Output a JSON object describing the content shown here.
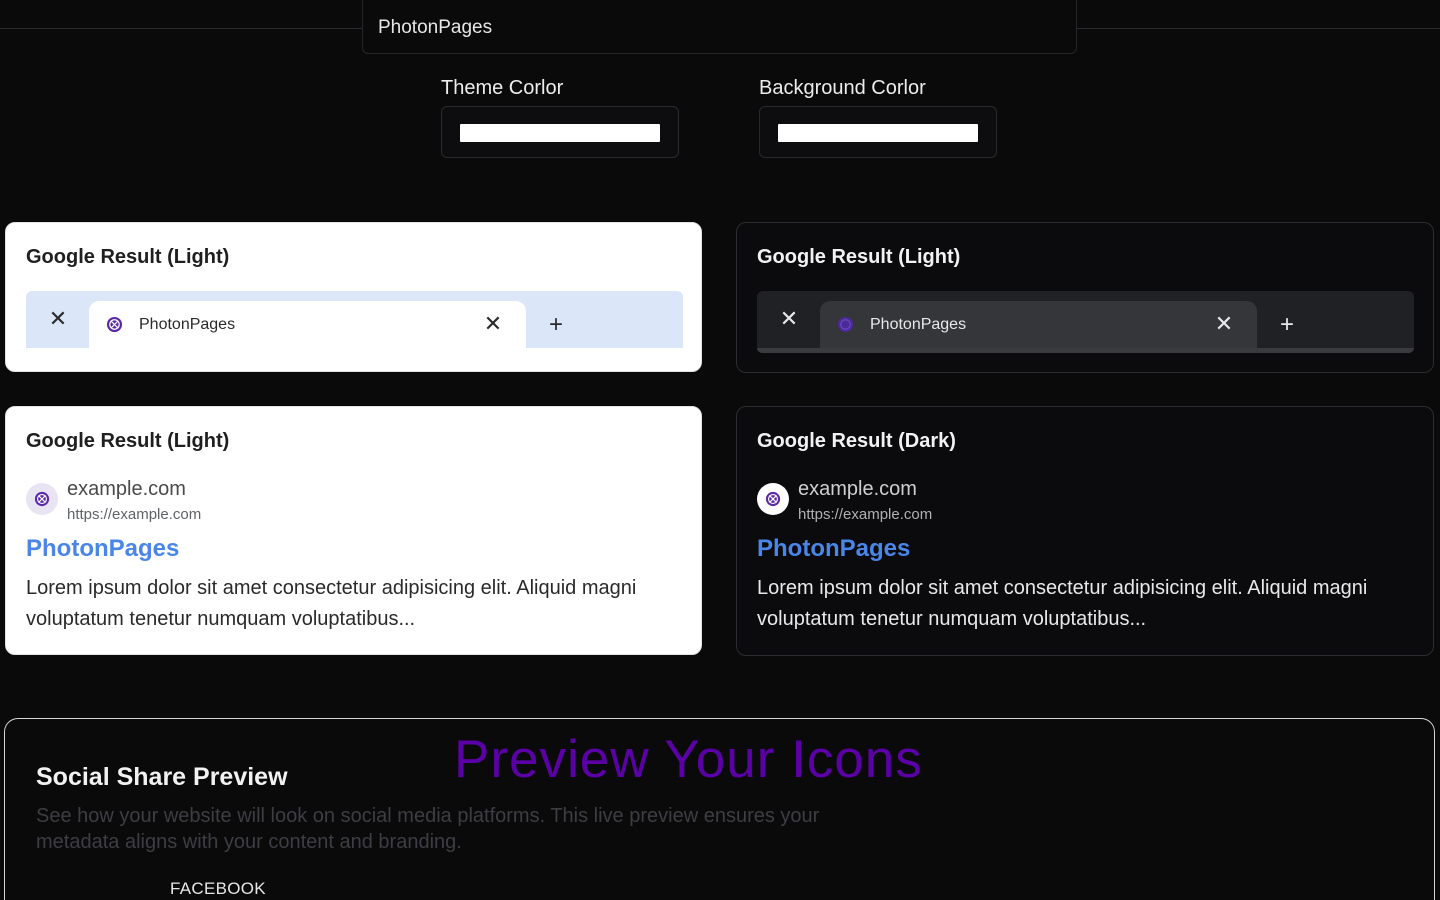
{
  "site_name_field": {
    "value": "PhotonPages"
  },
  "theme_color": {
    "label": "Theme Corlor",
    "value": "#ffffff"
  },
  "background_color": {
    "label": "Background Corlor",
    "value": "#ffffff"
  },
  "tab_preview_light": {
    "title": "Google Result (Light)",
    "tab_label": "PhotonPages",
    "close_left": "✕",
    "tab_close": "✕",
    "add": "+"
  },
  "tab_preview_dark": {
    "title": "Google Result (Light)",
    "tab_label": "PhotonPages",
    "close_left": "✕",
    "tab_close": "✕",
    "add": "+"
  },
  "serp_light": {
    "title": "Google Result (Light)",
    "site": "example.com",
    "url": "https://example.com",
    "page_title": "PhotonPages",
    "description": "Lorem ipsum dolor sit amet consectetur adipisicing elit. Aliquid magni voluptatum tenetur numquam voluptatibus..."
  },
  "serp_dark": {
    "title": "Google Result (Dark)",
    "site": "example.com",
    "url": "https://example.com",
    "page_title": "PhotonPages",
    "description": "Lorem ipsum dolor sit amet consectetur adipisicing elit. Aliquid magni voluptatum tenetur numquam voluptatibus..."
  },
  "social_share": {
    "title": "Social Share Preview",
    "description": "See how your website will look on social media platforms. This live preview ensures your metadata aligns with your content and branding.",
    "platform_tab": "FACEBOOK"
  },
  "preview_heading": "Preview Your Icons",
  "colors": {
    "link_blue": "#4a86e8",
    "favicon_purple": "#5b2aa6",
    "heading_purple": "#5b00a6"
  },
  "icons": {
    "favicon": "photonpages-logo-icon",
    "close": "close-icon",
    "add": "plus-icon"
  }
}
